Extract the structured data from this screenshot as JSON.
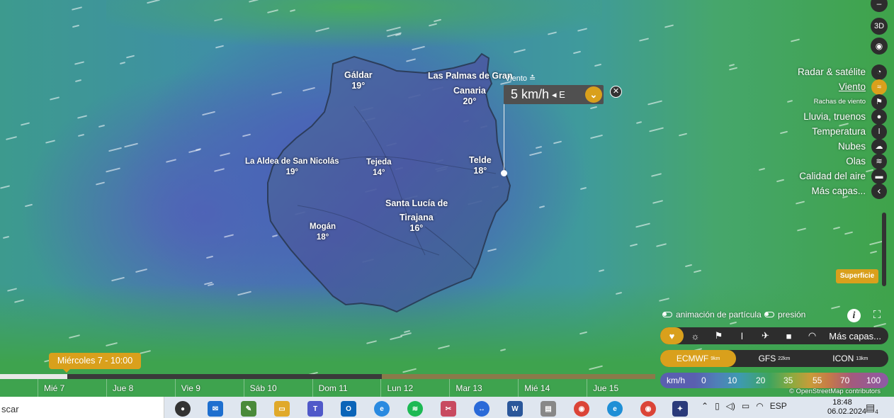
{
  "map": {
    "towns": [
      {
        "name": "Gáldar",
        "temp": "19°"
      },
      {
        "name": "Las Palmas de Gran",
        "temp": ""
      },
      {
        "name": "Canaria",
        "temp": "20°"
      },
      {
        "name": "La Aldea de San Nicolás",
        "temp": "19°"
      },
      {
        "name": "Tejeda",
        "temp": "14°"
      },
      {
        "name": "Telde",
        "temp": "18°"
      },
      {
        "name": "Santa Lucía de",
        "temp": ""
      },
      {
        "name": "Tirajana",
        "temp": "16°"
      },
      {
        "name": "Mogán",
        "temp": "18°"
      }
    ],
    "wind_popup": {
      "label": "Viento ≛",
      "value": "5 km/h",
      "direction": "◂ E",
      "expand_icon": "chevron-down-icon",
      "close_icon": "close-icon"
    }
  },
  "right_controls": {
    "top_buttons": [
      {
        "icon": "minus-icon",
        "glyph": "–"
      },
      {
        "icon": "3d-icon",
        "glyph": "3D"
      },
      {
        "icon": "hurricane-icon",
        "glyph": "◉"
      }
    ],
    "layers": [
      {
        "label": "Radar & satélite",
        "icon": "radar-icon",
        "glyph": "◔"
      },
      {
        "label": "Viento",
        "icon": "wind-icon",
        "glyph": "≈",
        "active": true
      },
      {
        "label": "Rachas de viento",
        "icon": "flag-icon",
        "glyph": "⚑"
      },
      {
        "label": "Lluvia, truenos",
        "icon": "drop-icon",
        "glyph": "●"
      },
      {
        "label": "Temperatura",
        "icon": "thermometer-icon",
        "glyph": "ǀ"
      },
      {
        "label": "Nubes",
        "icon": "cloud-icon",
        "glyph": "☁"
      },
      {
        "label": "Olas",
        "icon": "waves-icon",
        "glyph": "≋"
      },
      {
        "label": "Calidad del aire",
        "icon": "car-icon",
        "glyph": "▬"
      },
      {
        "label": "Más capas...",
        "icon": "chevron-left-icon",
        "glyph": "‹"
      }
    ],
    "surface_label": "Superficie"
  },
  "bottom_panel": {
    "particle_toggle": "animación de partícula",
    "pressure_toggle": "presión",
    "iconbar": [
      {
        "icon": "heart-icon",
        "glyph": "♥"
      },
      {
        "icon": "weather-icon",
        "glyph": "☼"
      },
      {
        "icon": "flag-icon",
        "glyph": "⚑"
      },
      {
        "icon": "thermometer-icon",
        "glyph": "ǀ"
      },
      {
        "icon": "plane-icon",
        "glyph": "✈"
      },
      {
        "icon": "camera-icon",
        "glyph": "■"
      },
      {
        "icon": "radar-icon",
        "glyph": "◠"
      }
    ],
    "more_layers": "Más capas...",
    "models": [
      {
        "name": "ECMWF",
        "res": "9km"
      },
      {
        "name": "GFS",
        "res": "22km"
      },
      {
        "name": "ICON",
        "res": "13km"
      }
    ],
    "legend": {
      "unit": "km/h",
      "ticks": [
        "0",
        "10",
        "20",
        "35",
        "55",
        "70",
        "100"
      ]
    },
    "attribution": "© OpenStreetMap contributors"
  },
  "timeline": {
    "current": "Miércoles 7 - 10:00",
    "days": [
      "Mié 7",
      "Jue 8",
      "Vie 9",
      "Sáb 10",
      "Dom 11",
      "Lun 12",
      "Mar 13",
      "Mié 14",
      "Jue 15"
    ]
  },
  "taskbar": {
    "search_text": "scar",
    "tray": {
      "language": "ESP",
      "time": "18:48",
      "date": "06.02.2024",
      "notification_count": "4"
    }
  }
}
